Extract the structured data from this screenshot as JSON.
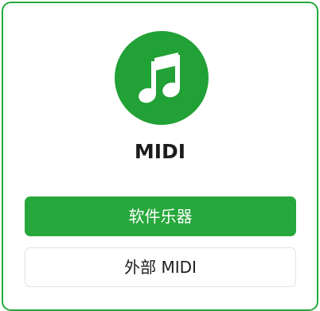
{
  "card": {
    "title": "MIDI",
    "icon": "music-note-icon",
    "accent_color": "#27a83c"
  },
  "buttons": {
    "software_instrument_label": "软件乐器",
    "external_midi_label": "外部 MIDI"
  }
}
